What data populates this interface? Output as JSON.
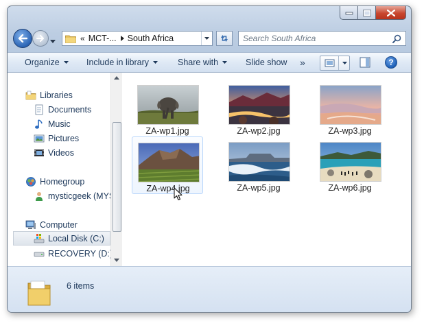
{
  "address": {
    "overflow_glyph": "«",
    "segments": [
      "MCT-...",
      "South Africa"
    ]
  },
  "search": {
    "placeholder": "Search South Africa"
  },
  "toolbar": {
    "organize": "Organize",
    "include": "Include in library",
    "share": "Share with",
    "slideshow": "Slide show",
    "more": "»",
    "help": "?"
  },
  "nav": {
    "libraries": "Libraries",
    "documents": "Documents",
    "music": "Music",
    "pictures": "Pictures",
    "videos": "Videos",
    "homegroup": "Homegroup",
    "user": "mysticgeek (MYS",
    "computer": "Computer",
    "local_disk": "Local Disk (C:)",
    "recovery": "RECOVERY (D:)"
  },
  "files": [
    {
      "name": "ZA-wp1.jpg",
      "icon": "elephant-photo"
    },
    {
      "name": "ZA-wp2.jpg",
      "icon": "rocky-river-sunset-photo"
    },
    {
      "name": "ZA-wp3.jpg",
      "icon": "pink-coast-photo"
    },
    {
      "name": "ZA-wp4.jpg",
      "icon": "mountain-vineyard-photo"
    },
    {
      "name": "ZA-wp5.jpg",
      "icon": "table-mountain-waves-photo"
    },
    {
      "name": "ZA-wp6.jpg",
      "icon": "penguin-beach-photo"
    }
  ],
  "status": {
    "count": "6 items"
  },
  "colors": {
    "frame": "#bccde2",
    "accent": "#1e395b",
    "selection": "#b8d6fb",
    "close_button": "#c8472f"
  }
}
